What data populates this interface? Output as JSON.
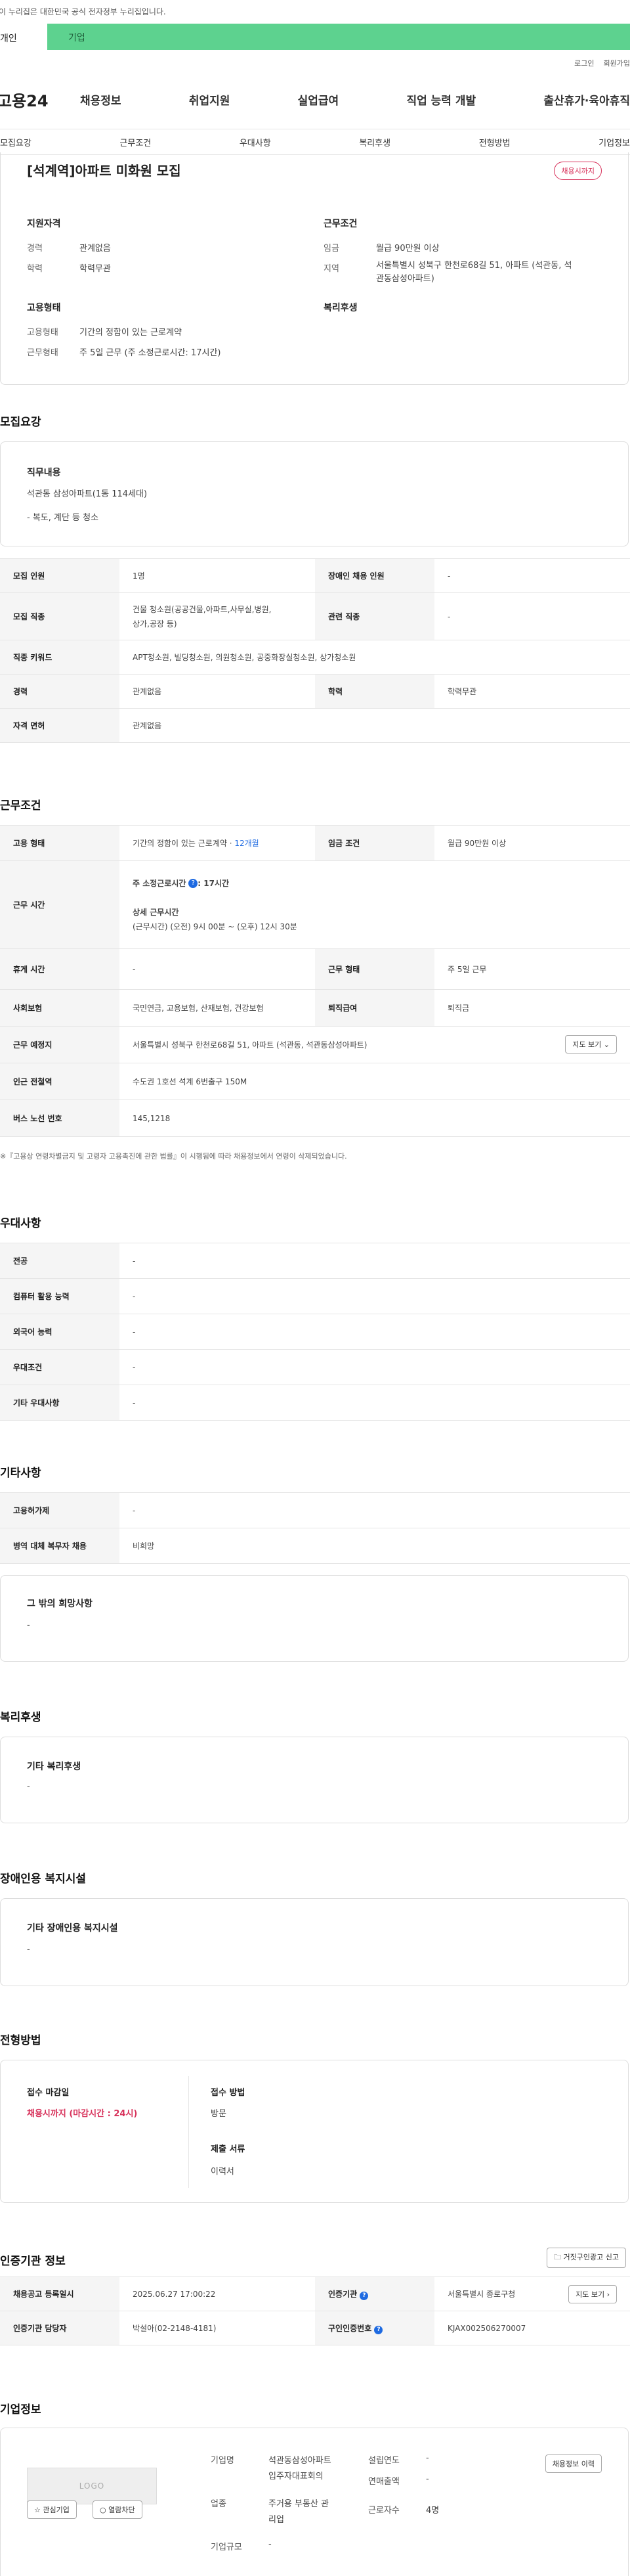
{
  "gov_notice": "이 누리집은 대한민국 공식 전자정부 누리집입니다.",
  "audience": {
    "left": "개인",
    "right": "기업"
  },
  "util": [
    "로그인",
    "회원가입"
  ],
  "logo": "고용24",
  "gnb": [
    "채용정보",
    "취업지원",
    "실업급여",
    "직업 능력 개발",
    "출산휴가·육아휴직"
  ],
  "tabs": [
    "모집요강",
    "근무조건",
    "우대사항",
    "복리후생",
    "전형방법",
    "기업정보"
  ],
  "summary": {
    "title": "[석계역]아파트 미화원 모집",
    "badge": "채용시까지",
    "qual_h": "지원자격",
    "career_k": "경력",
    "career_v": "관계없음",
    "edu_k": "학력",
    "edu_v": "학력무관",
    "work_h": "근무조건",
    "wage_k": "임금",
    "wage_v": "월급 90만원 이상",
    "area_k": "지역",
    "area_v1": "서울특별시 성북구 한천로68길 51, 아파트 (석관동, 석",
    "area_v2": "관동삼성아파트)",
    "emp_h": "고용형태",
    "emp_k": "고용형태",
    "emp_v": "기간의 정함이 있는 근로계약",
    "work_k": "근무형태",
    "work_v": "주 5일 근무 (주 소정근로시간: 17시간)",
    "welfare_h": "복리후생"
  },
  "recruit": {
    "h": "모집요강",
    "duty_h": "직무내용",
    "duty_1": "석관동 삼성아파트(1동 114세대)",
    "duty_2": "- 복도, 계단 등 청소",
    "rows": [
      {
        "k1": "모집 인원",
        "v1": "1명",
        "k2": "장애인 채용 인원",
        "v2": "-"
      },
      {
        "k1": "모집 직종",
        "v1a": "건물 청소원(공공건물,아파트,사무실,병원,",
        "v1b": "상가,공장 등)",
        "k2": "관련 직종",
        "v2": "-"
      },
      {
        "k1": "직종 키워드",
        "v1": "APT청소원, 빌딩청소원, 의원청소원, 공중화장실청소원, 상가청소원"
      },
      {
        "k1": "경력",
        "v1": "관계없음",
        "k2": "학력",
        "v2": "학력무관"
      },
      {
        "k1": "자격 면허",
        "v1": "관계없음"
      }
    ]
  },
  "conditions": {
    "h": "근무조건",
    "emp_k": "고용 형태",
    "emp_v": "기간의 정함이 있는 근로계약 · ",
    "emp_v2": "12개월",
    "wage_k": "임금 조건",
    "wage_v": "월급 90만원 이상",
    "time_k": "근무 시간",
    "time_1": "주 소정근로시간",
    "time_1v": ": 17시간",
    "time_2": "상세 근무시간",
    "time_3": "(근무시간) (오전) 9시 00분 ~ (오후) 12시 30분",
    "rest_k": "휴게 시간",
    "rest_v": "-",
    "form_k": "근무 형태",
    "form_v": "주 5일 근무",
    "ins_k": "사회보험",
    "ins_v": "국민연금, 고용보험, 산재보험, 건강보험",
    "sev_k": "퇴직급여",
    "sev_v": "퇴직금",
    "place_k": "근무 예정지",
    "place_v": "서울특별시 성북구 한천로68길 51, 아파트 (석관동, 석관동삼성아파트)",
    "map_btn": "지도 보기",
    "sub_k": "인근 전철역",
    "sub_v": "수도권 1호선 석계 6번출구 150M",
    "bus_k": "버스 노선 번호",
    "bus_v": "145,1218",
    "note": "※『고용상 연령차별금지 및 고령자 고용촉진에 관한 법률』이 시행됨에 따라 채용정보에서 연령이 삭제되었습니다."
  },
  "preference": {
    "h": "우대사항",
    "rows": [
      {
        "k": "전공",
        "v": "-"
      },
      {
        "k": "컴퓨터 활용 능력",
        "v": "-"
      },
      {
        "k": "외국어 능력",
        "v": "-"
      },
      {
        "k": "우대조건",
        "v": "-"
      },
      {
        "k": "기타 우대사항",
        "v": "-"
      }
    ]
  },
  "other": {
    "h": "기타사항",
    "rows": [
      {
        "k": "고용허가제",
        "v": "-"
      },
      {
        "k": "병역 대체 복무자 채용",
        "v": "비희망"
      }
    ],
    "wish_h": "그 밖의 희망사항",
    "wish_v": "-"
  },
  "welfare": {
    "h": "복리후생",
    "item_h": "기타 복리후생",
    "item_v": "-"
  },
  "disabled": {
    "h": "장애인용 복지시설",
    "item_h": "기타 장애인용 복지시설",
    "item_v": "-"
  },
  "screening": {
    "h": "전형방법",
    "deadline_h": "접수 마감일",
    "deadline_v": "채용시까지 (마감시간 : 24시)",
    "method_h": "접수 방법",
    "method_v": "방문",
    "docs_h": "제출 서류",
    "docs_v": "이력서"
  },
  "cert": {
    "h": "인증기관 정보",
    "report_btn": "거짓구인광고 신고",
    "reg_k": "채용공고 등록일시",
    "reg_v": "2025.06.27 17:00:22",
    "org_k": "인증기관",
    "org_v": "서울특별시 종로구청",
    "map_btn": "지도 보기",
    "staff_k": "인증기관 담당자",
    "staff_v": "박설아(02-2148-4181)",
    "num_k": "구인인증번호",
    "num_v": "KJAX002506270007"
  },
  "company": {
    "h": "기업정보",
    "logo": "LOGO",
    "fav_btn": "관심기업",
    "block_btn": "열람차단",
    "hist_btn": "채용정보 이력",
    "name_k": "기업명",
    "name_v1": "석관동삼성아파트",
    "name_v2": "입주자대표회의",
    "found_k": "설립연도",
    "found_v": "-",
    "sales_k": "연매출액",
    "sales_v": "-",
    "ind_k": "업종",
    "ind_v1": "주거용 부동산 관",
    "ind_v2": "리업",
    "emp_k": "근로자수",
    "emp_v": "4명",
    "size_k": "기업규모",
    "size_v": "-"
  },
  "colors": {
    "accent_green": "#5dd28f",
    "badge_red": "#d7315a",
    "link_blue": "#1e6ae1"
  }
}
